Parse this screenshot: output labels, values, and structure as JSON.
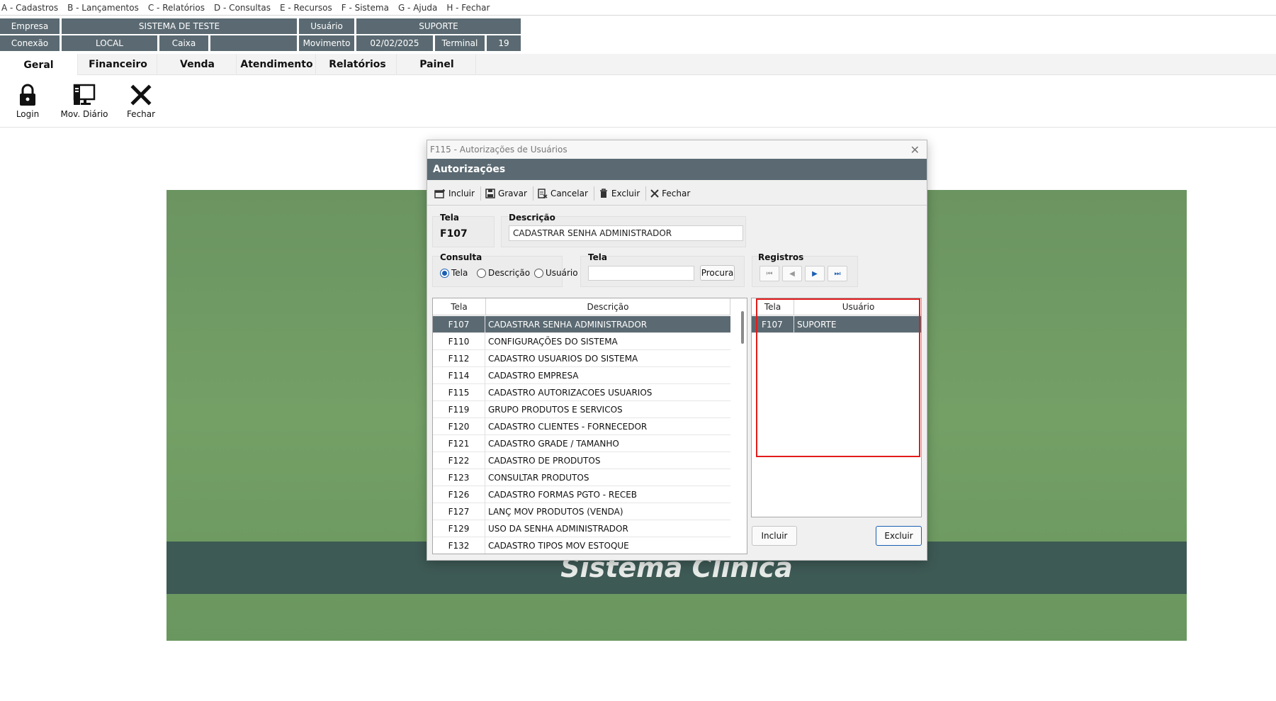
{
  "menu": [
    "A - Cadastros",
    "B - Lançamentos",
    "C - Relatórios",
    "D - Consultas",
    "E - Recursos",
    "F - Sistema",
    "G - Ajuda",
    "H - Fechar"
  ],
  "info": {
    "empresa_label": "Empresa",
    "empresa_value": "SISTEMA DE TESTE",
    "usuario_label": "Usuário",
    "usuario_value": "SUPORTE",
    "conexao_label": "Conexão",
    "conexao_value": "LOCAL",
    "caixa_label": "Caixa",
    "caixa_value": "",
    "movimento_label": "Movimento",
    "movimento_value": "02/02/2025",
    "terminal_label": "Terminal",
    "terminal_value": "19"
  },
  "tabs": [
    "Geral",
    "Financeiro",
    "Venda",
    "Atendimento",
    "Relatórios",
    "Painel"
  ],
  "ribbon": [
    "Login",
    "Mov. Diário",
    "Fechar"
  ],
  "banner_text": "Sistema Clínica",
  "dialog": {
    "title": "F115 - Autorizações de Usuários",
    "header": "Autorizações",
    "toolbar": [
      "Incluir",
      "Gravar",
      "Cancelar",
      "Excluir",
      "Fechar"
    ],
    "tela_label": "Tela",
    "tela_value": "F107",
    "descricao_label": "Descrição",
    "descricao_value": "CADASTRAR SENHA ADMINISTRADOR",
    "consulta_label": "Consulta",
    "consulta_options": [
      "Tela",
      "Descrição",
      "Usuário"
    ],
    "consulta_selected": "Tela",
    "busca_label": "Tela",
    "busca_value": "",
    "procura_button": "Procura",
    "registros_label": "Registros",
    "main_grid": {
      "headers": [
        "Tela",
        "Descrição"
      ],
      "rows": [
        [
          "F107",
          "CADASTRAR SENHA ADMINISTRADOR"
        ],
        [
          "F110",
          "CONFIGURAÇÕES DO SISTEMA"
        ],
        [
          "F112",
          "CADASTRO USUARIOS DO SISTEMA"
        ],
        [
          "F114",
          "CADASTRO EMPRESA"
        ],
        [
          "F115",
          "CADASTRO AUTORIZACOES USUARIOS"
        ],
        [
          "F119",
          "GRUPO PRODUTOS E SERVICOS"
        ],
        [
          "F120",
          "CADASTRO CLIENTES - FORNECEDOR"
        ],
        [
          "F121",
          "CADASTRO GRADE / TAMANHO"
        ],
        [
          "F122",
          "CADASTRO DE PRODUTOS"
        ],
        [
          "F123",
          "CONSULTAR PRODUTOS"
        ],
        [
          "F126",
          "CADASTRO FORMAS PGTO - RECEB"
        ],
        [
          "F127",
          "LANÇ MOV PRODUTOS (VENDA)"
        ],
        [
          "F129",
          "USO DA SENHA ADMINISTRADOR"
        ],
        [
          "F132",
          "CADASTRO TIPOS MOV ESTOQUE"
        ]
      ]
    },
    "user_grid": {
      "headers": [
        "Tela",
        "Usuário"
      ],
      "rows": [
        [
          "F107",
          "SUPORTE"
        ]
      ]
    },
    "incluir_button": "Incluir",
    "excluir_button": "Excluir"
  },
  "colors": {
    "header_bg": "#5b6a72",
    "banner_green": "#6f9b63",
    "banner_strip": "#3e5a55",
    "highlight": "#e31c1c",
    "accent": "#1a5fb4"
  }
}
